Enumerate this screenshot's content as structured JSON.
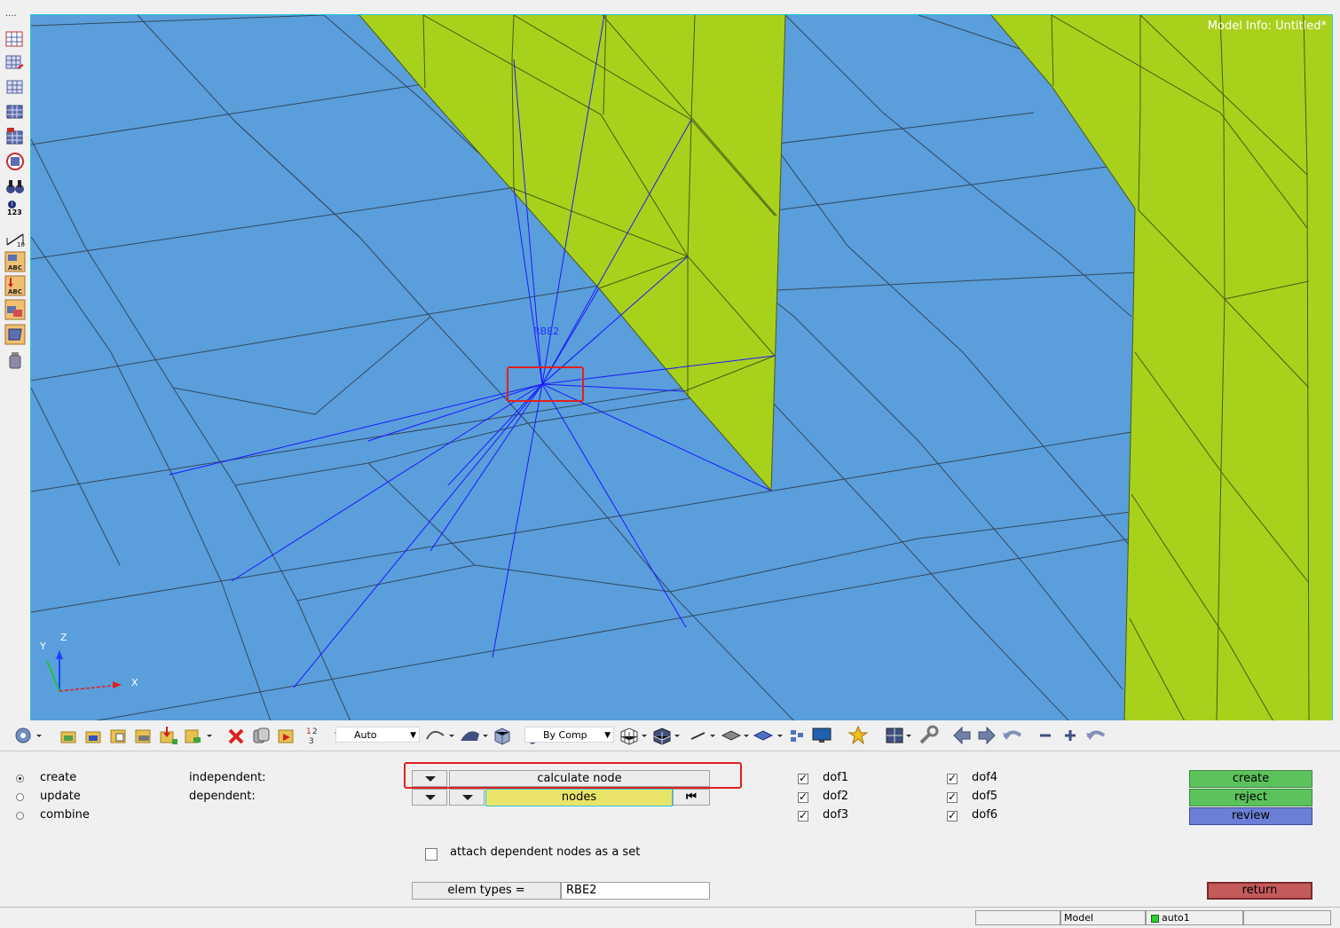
{
  "viewport": {
    "model_info": "Model Info: Untitled*",
    "rbe2_label": "RBE2",
    "axis": {
      "x": "X",
      "y": "Y",
      "z": "Z"
    },
    "colors": {
      "background": "#5a9edb",
      "shell": "#a8d11c",
      "rigid": "#1a1aff",
      "mesh_edge": "#2a3a4a",
      "highlight": "#e02020"
    }
  },
  "left_toolbar": {
    "icons": [
      "menu-dots-icon",
      "mask-panel-icon",
      "find-panel-icon",
      "geometry-panel-icon",
      "mesh-panel-icon",
      "no-mesh-panel-icon",
      "find-attached-icon",
      "numbers-icon",
      "distance-icon",
      "label-components-icon",
      "label-elements-icon",
      "components-visibility-icon",
      "node-mass-icon",
      "weight-icon"
    ],
    "numbers_label": "123"
  },
  "bottom_toolbar": {
    "display_mode": "Auto",
    "color_mode": "By Comp"
  },
  "panel": {
    "modes": [
      {
        "label": "create",
        "selected": true
      },
      {
        "label": "update",
        "selected": false
      },
      {
        "label": "combine",
        "selected": false
      }
    ],
    "independent_label": "independent:",
    "dependent_label": "dependent:",
    "independent_button": "calculate node",
    "dependent_button": "nodes",
    "dofs": [
      {
        "label": "dof1",
        "checked": true
      },
      {
        "label": "dof2",
        "checked": true
      },
      {
        "label": "dof3",
        "checked": true
      },
      {
        "label": "dof4",
        "checked": true
      },
      {
        "label": "dof5",
        "checked": true
      },
      {
        "label": "dof6",
        "checked": true
      }
    ],
    "attach_label": "attach dependent nodes as a set",
    "attach_checked": false,
    "elem_types_button": "elem types =",
    "elem_types_value": "RBE2",
    "actions": {
      "create": "create",
      "reject": "reject",
      "review": "review",
      "return": "return"
    },
    "action_colors": {
      "create": "#5cc35c",
      "reject": "#5cc35c",
      "review": "#6b7fd6",
      "return": "#c45a5a"
    }
  },
  "status": {
    "model_label": "Model",
    "collector": "auto1"
  }
}
